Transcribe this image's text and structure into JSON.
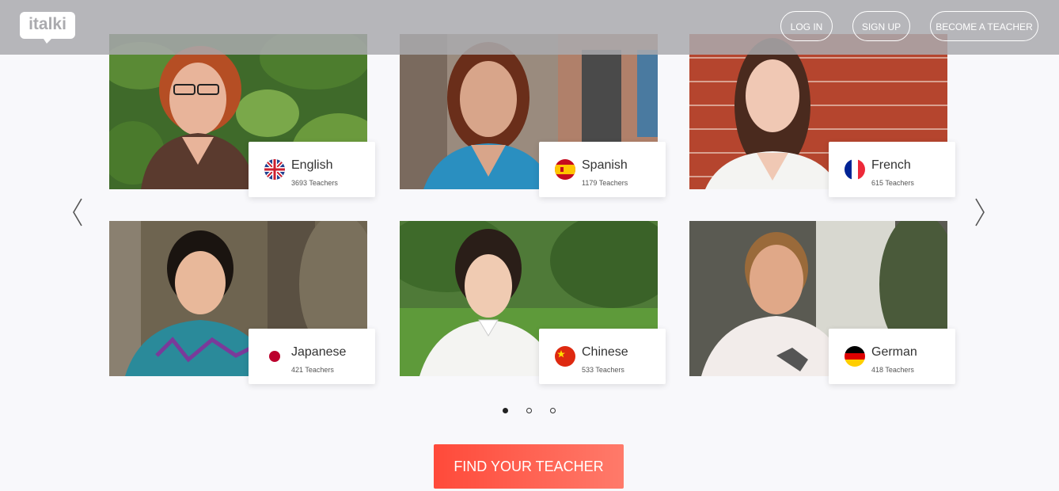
{
  "header": {
    "logo_text": "italki",
    "login_label": "LOG IN",
    "signup_label": "SIGN UP",
    "become_teacher_label": "BECOME A TEACHER"
  },
  "languages": [
    {
      "name": "English",
      "teachers": "3693 Teachers",
      "flag": "uk-flag"
    },
    {
      "name": "Spanish",
      "teachers": "1179 Teachers",
      "flag": "spain-flag"
    },
    {
      "name": "French",
      "teachers": "615 Teachers",
      "flag": "france-flag"
    },
    {
      "name": "Japanese",
      "teachers": "421 Teachers",
      "flag": "japan-flag"
    },
    {
      "name": "Chinese",
      "teachers": "533 Teachers",
      "flag": "china-flag"
    },
    {
      "name": "German",
      "teachers": "418 Teachers",
      "flag": "germany-flag"
    }
  ],
  "carousel": {
    "prev_icon": "chevron-left-icon",
    "next_icon": "chevron-right-icon",
    "pages": 3,
    "active_page": 1
  },
  "cta": {
    "label": "FIND YOUR TEACHER"
  },
  "colors": {
    "accent_start": "#ff4a3a",
    "accent_end": "#ff7a6a",
    "header_bg": "#aaaaae"
  }
}
